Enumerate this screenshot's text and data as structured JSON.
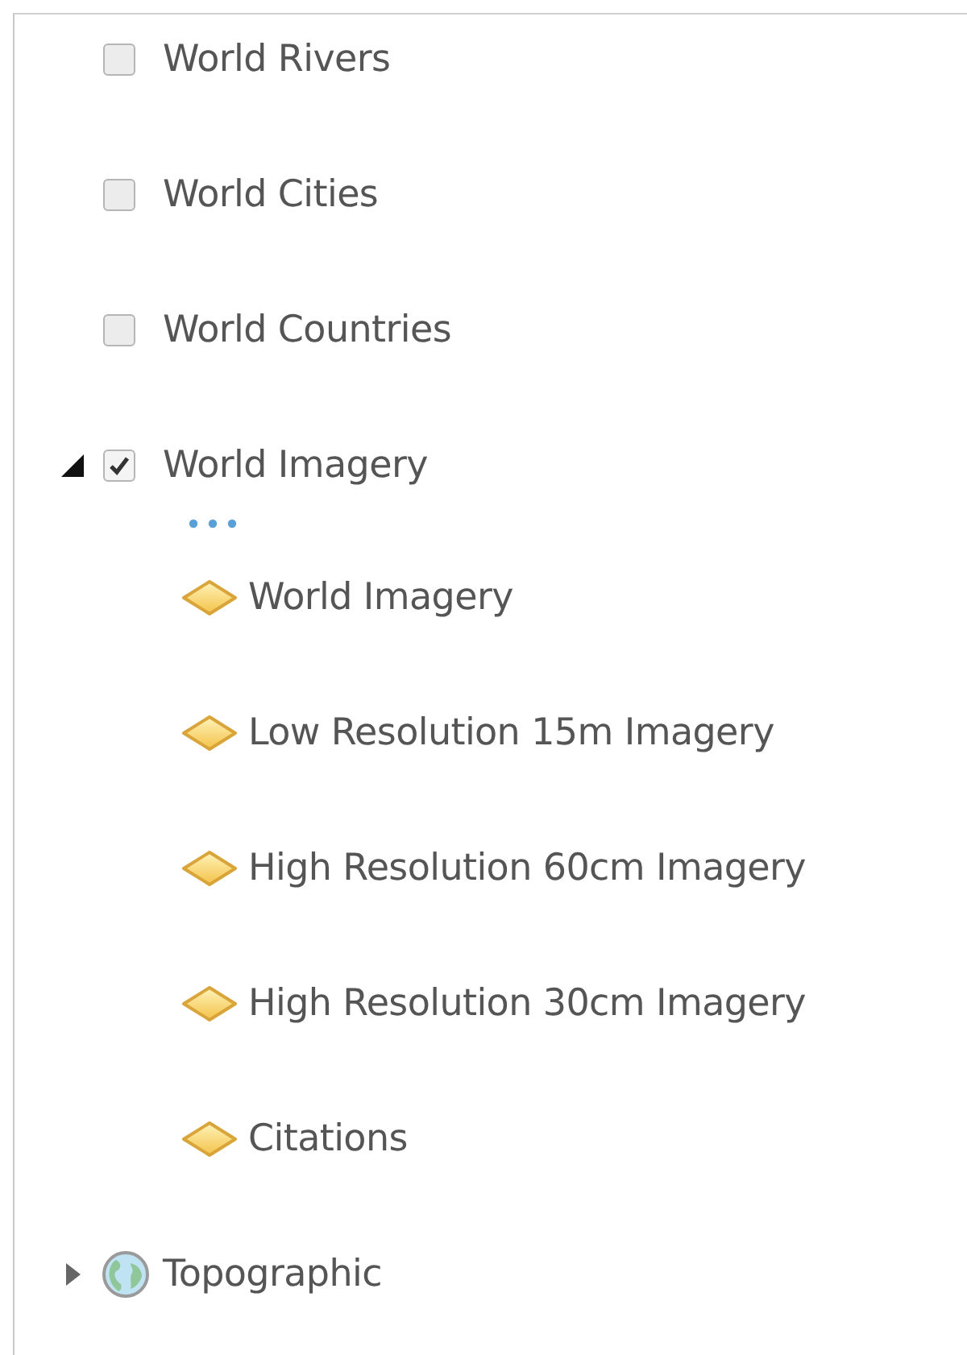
{
  "layers": [
    {
      "kind": "checkbox",
      "label": "World Rivers",
      "checked": false
    },
    {
      "kind": "checkbox",
      "label": "World Cities",
      "checked": false
    },
    {
      "kind": "checkbox",
      "label": "World Countries",
      "checked": false
    },
    {
      "kind": "checkbox",
      "label": "World Imagery",
      "checked": true,
      "expanded": true,
      "children": [
        {
          "label": "World Imagery"
        },
        {
          "label": "Low Resolution 15m Imagery"
        },
        {
          "label": "High Resolution 60cm Imagery"
        },
        {
          "label": "High Resolution 30cm Imagery"
        },
        {
          "label": "Citations"
        }
      ]
    },
    {
      "kind": "basemap",
      "label": "Topographic",
      "expanded": false
    }
  ]
}
